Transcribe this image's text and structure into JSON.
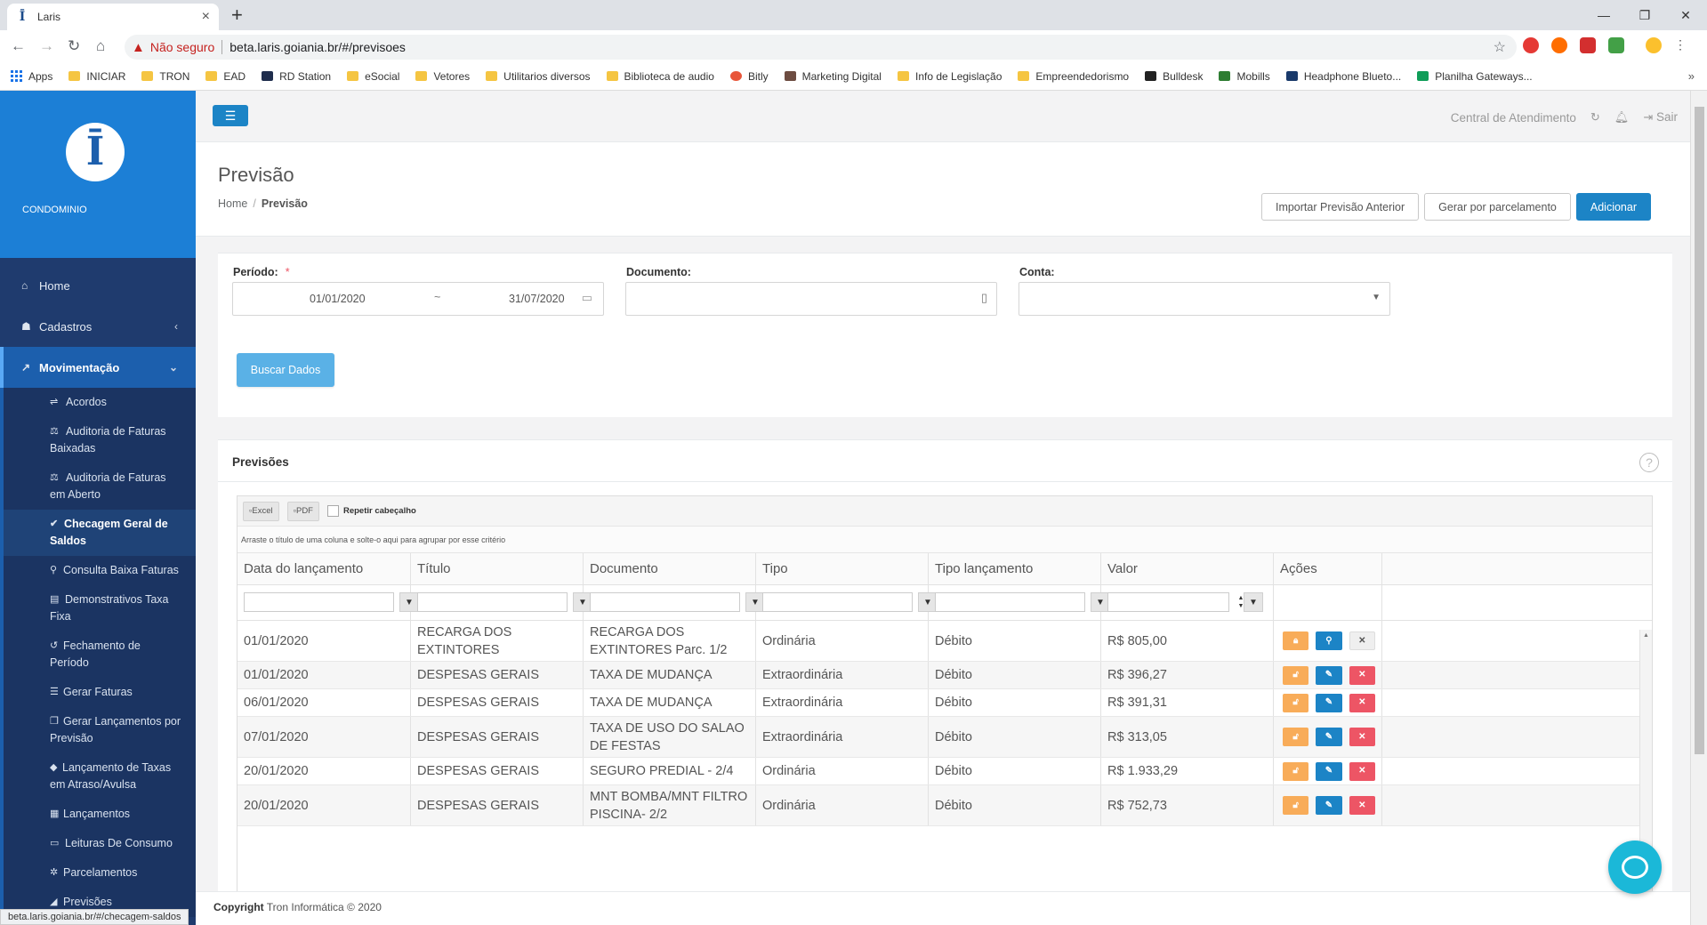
{
  "browser": {
    "tab_title": "Laris",
    "tab_favicon": "Ī",
    "security_label": "Não seguro",
    "url": "beta.laris.goiania.br/#/previsoes",
    "status_url": "beta.laris.goiania.br/#/checagem-saldos",
    "bookmarks": [
      "Apps",
      "INICIAR",
      "TRON",
      "EAD",
      "RD Station",
      "eSocial",
      "Vetores",
      "Utilitarios diversos",
      "Biblioteca de audio",
      "Bitly",
      "Marketing Digital",
      "Info de Legislação",
      "Empreendedorismo",
      "Bulldesk",
      "Mobills",
      "Headphone Blueto...",
      "Planilha Gateways..."
    ]
  },
  "sidebar": {
    "brand": "CONDOMINIO",
    "logo_text": "Ī",
    "items": [
      {
        "label": "Home",
        "icon": "home-icon"
      },
      {
        "label": "Cadastros",
        "icon": "sitemap-icon"
      },
      {
        "label": "Movimentação",
        "icon": "chart-line-icon"
      }
    ],
    "sub_items": [
      {
        "label": "Acordos",
        "icon": "handshake-icon"
      },
      {
        "label": "Auditoria de Faturas Baixadas",
        "icon": "balance-icon"
      },
      {
        "label": "Auditoria de Faturas em Aberto",
        "icon": "balance-icon"
      },
      {
        "label": "Checagem Geral de Saldos",
        "icon": "check-icon"
      },
      {
        "label": "Consulta Baixa Faturas",
        "icon": "search-icon"
      },
      {
        "label": "Demonstrativos Taxa Fixa",
        "icon": "table-icon"
      },
      {
        "label": "Fechamento de Período",
        "icon": "history-icon"
      },
      {
        "label": "Gerar Faturas",
        "icon": "list-icon"
      },
      {
        "label": "Gerar Lançamentos por Previsão",
        "icon": "copy-icon"
      },
      {
        "label": "Lançamento de Taxas em Atraso/Avulsa",
        "icon": "tag-icon"
      },
      {
        "label": "Lançamentos",
        "icon": "files-icon"
      },
      {
        "label": "Leituras De Consumo",
        "icon": "meter-icon"
      },
      {
        "label": "Parcelamentos",
        "icon": "puzzle-icon"
      },
      {
        "label": "Previsões",
        "icon": "chart-area-icon"
      }
    ]
  },
  "topbar": {
    "support": "Central de Atendimento",
    "logout": "Sair"
  },
  "heading": {
    "title": "Previsão",
    "breadcrumb_home": "Home",
    "breadcrumb_current": "Previsão",
    "btn_import": "Importar Previsão Anterior",
    "btn_generate": "Gerar por parcelamento",
    "btn_add": "Adicionar"
  },
  "filters": {
    "period_label": "Período:",
    "required_mark": "*",
    "date_from": "01/01/2020",
    "date_sep": "~",
    "date_to": "31/07/2020",
    "document_label": "Documento:",
    "document_value": "",
    "account_label": "Conta:",
    "account_value": "",
    "search_button": "Buscar Dados"
  },
  "list": {
    "title": "Previsões",
    "export_excel": "Excel",
    "export_pdf": "PDF",
    "repeat_header": "Repetir cabeçalho",
    "group_hint": "Arraste o título de uma coluna e solte-o aqui para agrupar por esse critério",
    "columns": [
      "Data do lançamento",
      "Título",
      "Documento",
      "Tipo",
      "Tipo lançamento",
      "Valor",
      "Ações"
    ],
    "rows": [
      {
        "date": "01/01/2020",
        "title": "RECARGA DOS EXTINTORES",
        "document": "RECARGA DOS EXTINTORES Parc. 1/2",
        "type": "Ordinária",
        "entry": "Débito",
        "value": "R$ 805,00",
        "locked": true
      },
      {
        "date": "01/01/2020",
        "title": "DESPESAS GERAIS",
        "document": "TAXA DE MUDANÇA",
        "type": "Extraordinária",
        "entry": "Débito",
        "value": "R$ 396,27",
        "locked": false
      },
      {
        "date": "06/01/2020",
        "title": "DESPESAS GERAIS",
        "document": "TAXA DE MUDANÇA",
        "type": "Extraordinária",
        "entry": "Débito",
        "value": "R$ 391,31",
        "locked": false
      },
      {
        "date": "07/01/2020",
        "title": "DESPESAS GERAIS",
        "document": "TAXA DE USO DO SALAO DE FESTAS",
        "type": "Extraordinária",
        "entry": "Débito",
        "value": "R$ 313,05",
        "locked": false
      },
      {
        "date": "20/01/2020",
        "title": "DESPESAS GERAIS",
        "document": "SEGURO PREDIAL - 2/4",
        "type": "Ordinária",
        "entry": "Débito",
        "value": "R$ 1.933,29",
        "locked": false
      },
      {
        "date": "20/01/2020",
        "title": "DESPESAS GERAIS",
        "document": "MNT BOMBA/MNT FILTRO PISCINA- 2/2",
        "type": "Ordinária",
        "entry": "Débito",
        "value": "R$ 752,73",
        "locked": false
      }
    ]
  },
  "footer": {
    "copyright_label": "Copyright",
    "copyright_text": "Tron Informática © 2020"
  },
  "colors": {
    "sidebar_bg": "#1f3b6e",
    "brand_bg": "#1c7fd6",
    "primary": "#1c84c6",
    "warning": "#f8ac59",
    "danger": "#ed5565",
    "chat": "#1bb8d8"
  }
}
